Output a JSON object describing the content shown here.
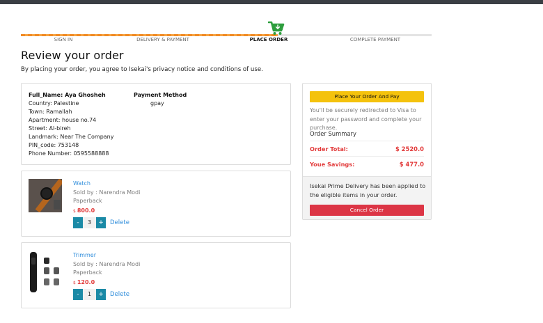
{
  "progress": {
    "steps": [
      "SIGN IN",
      "DELIVERY & PAYMENT",
      "PLACE ORDER",
      "COMPLETE PAYMENT"
    ],
    "active_step": 3,
    "completed_fraction": 0.625,
    "colors": {
      "filled": "#f08a24",
      "track": "#e4e4e4",
      "cart_icon": "#2e9e3e"
    }
  },
  "page": {
    "title": "Review your order",
    "subtitle": "By placing your order, you agree to Isekai's privacy notice and conditions of use."
  },
  "address": {
    "name": "Full_Name: Aya Ghosheh",
    "lines": [
      "Country: Palestine",
      "Town: Ramallah",
      "Apartment: house no.74",
      "Street: Al-bireh",
      "Landmark: Near The Company",
      "PIN_code: 753148",
      "Phone Number: 0595588888"
    ]
  },
  "payment": {
    "title": "Payment Method",
    "value": "gpay"
  },
  "items": [
    {
      "name": "Watch",
      "seller": "Sold by : Narendra Modi",
      "format": "Paperback",
      "currency": "$",
      "price": "800.0",
      "qty": "3",
      "minus": "-",
      "plus": "+",
      "delete": "Delete",
      "icon": "watch-image"
    },
    {
      "name": "Trimmer",
      "seller": "Sold by : Narendra Modi",
      "format": "Paperback",
      "currency": "$",
      "price": "120.0",
      "qty": "1",
      "minus": "-",
      "plus": "+",
      "delete": "Delete",
      "icon": "trimmer-image"
    }
  ],
  "summary": {
    "place_button": "Place Your Order And Pay",
    "redirect_note": "You'll be securely redirected to Visa to enter your password and complete your purchase.",
    "order_summary_title": "Order Summary",
    "order_total_label": "Order Total:",
    "order_total_value": "$ 2520.0",
    "savings_label": "Youe Savings:",
    "savings_value": "$ 477.0",
    "prime_note": "Isekai Prime Delivery has been applied to the eligible items in your order.",
    "cancel_button": "Cancel Order"
  },
  "colors": {
    "accent_blue": "#2f8ddb",
    "qty_button": "#1b8aa6",
    "price_red": "#e23b3b",
    "place_button": "#f4c20d",
    "cancel_button": "#dc3545"
  }
}
